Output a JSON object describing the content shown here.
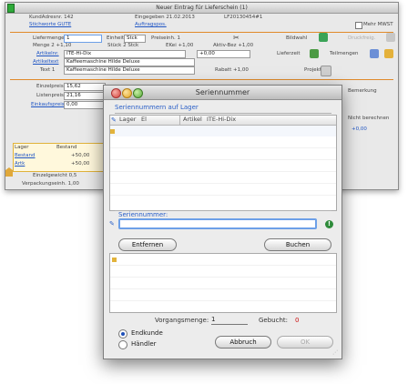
{
  "background_window": {
    "title": "Neuer Eintrag für Lieferschein (1)",
    "kundennummer_label": "KundAdresnr. 142",
    "erfasst_label": "Eingegeben 21.02.2013",
    "belegnr": "LF20130454#1",
    "stichwort_link": "Stichworte GUTE",
    "auftrag_link": "Auftragspos.",
    "mehr_label": "Mehr MWST",
    "liefermenge_label": "Liefermenge",
    "liefermenge_value": "1",
    "menge_label": "Menge 2 +1,10",
    "einheit_label": "Einheit",
    "einheit_value": "Stck",
    "preiseinheit_label": "Preiseinh. 1",
    "stueck_label": "Stück 2 Stck",
    "ekei_label": "EKei +1,00",
    "aktiv_label": "Aktiv-Bez +1,00",
    "artikel_link": "Artikelnr.",
    "artikel_value": "ITE-Hi-Dix",
    "bez_link": "Artikeltext",
    "bez_value": "Kaffeemaschine Hilde Deluxe",
    "bez2_label": "Text 1",
    "bez2_value": "Kaffeemaschine Hilde Deluxe",
    "rabatt_label": "Rabatt +1,00",
    "einzelpreis_label": "Einzelpreis",
    "einzelpreis_value": "15,62",
    "listenpreis_label": "Listenpreis",
    "listenpreis_value": "21,16",
    "einkaufspreis_label": "Einkaufspreis",
    "einkaufspreis_value": "0,00",
    "lager_label": "Lager",
    "bestand_label": "Bestand",
    "lager_rows": [
      {
        "name": "Bestand",
        "value": "+50,00"
      },
      {
        "name": "Artk",
        "value": "+50,00"
      }
    ],
    "einzelgewicht_label": "Einzelgewicht 0,5",
    "verpackung_label": "Verpackungseinh. 1,00",
    "bildwahl_label": "Bildwahl",
    "druck_label": "Druckfreig.",
    "lieferzeit_label": "Lieferzeit",
    "teil_label": "Teilmengen",
    "projekt_label": "Projekt",
    "bemerkung_label": "Bemerkung",
    "nicht_label": "Nicht berechnen",
    "rechts_value": "+0,00"
  },
  "dialog": {
    "title": "Seriennummer",
    "section_on_stock": "Seriennummern auf Lager",
    "col_lager": "Lager",
    "col_lager_suffix": "El",
    "col_artikel": "Artikel",
    "col_artikel_value": "ITE-Hi-Dix",
    "section_serial": "Seriennummer:",
    "serial_value": "",
    "remove_button": "Entfernen",
    "book_button": "Buchen",
    "vorgangsmenge_label": "Vorgangsmenge:",
    "vorgangsmenge_value": "1",
    "gebucht_label": "Gebucht:",
    "gebucht_value": "0",
    "radio_endkunde": "Endkunde",
    "radio_haendler": "Händler",
    "cancel_button": "Abbruch",
    "ok_button": "OK",
    "colors": {
      "accent": "#2a5fc7",
      "gebucht": "#cc1111"
    }
  }
}
